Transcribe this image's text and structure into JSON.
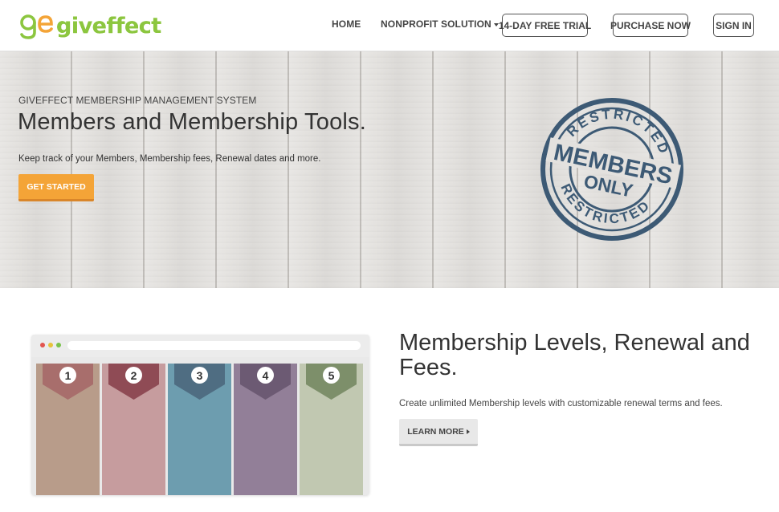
{
  "header": {
    "logo_text": "giveffect",
    "logo_mark": "ge",
    "nav": {
      "home": "HOME",
      "nonprofit": "NONPROFIT SOLUTION",
      "trial": "14-DAY FREE TRIAL",
      "purchase": "PURCHASE NOW",
      "signin": "SIGN IN"
    }
  },
  "hero": {
    "kicker": "GIVEFFECT MEMBERSHIP MANAGEMENT SYSTEM",
    "title": "Members and Membership Tools.",
    "description": "Keep track of your Members, Membership fees, Renewal dates and more.",
    "cta_label": "GET STARTED",
    "stamp": {
      "top_text": "RESTRICTED",
      "bottom_text": "RESTRICTED",
      "line1": "MEMBERS",
      "line2": "ONLY"
    }
  },
  "feature": {
    "title": "Membership Levels, Renewal and Fees.",
    "description": "Create unlimited Membership levels with customizable renewal terms and fees.",
    "button_label": "LEARN MORE",
    "levels": [
      {
        "number": "1",
        "column_color": "#b89c8a",
        "tag_color": "#a86e6c"
      },
      {
        "number": "2",
        "column_color": "#c69c9e",
        "tag_color": "#8f4b55"
      },
      {
        "number": "3",
        "column_color": "#6d9daf",
        "tag_color": "#4f6d82"
      },
      {
        "number": "4",
        "column_color": "#927f98",
        "tag_color": "#6c5a73"
      },
      {
        "number": "5",
        "column_color": "#c1c8b1",
        "tag_color": "#7d8f6a"
      }
    ]
  },
  "colors": {
    "brand_green": "#8cc63f",
    "brand_orange": "#f4a437",
    "stamp_blue": "#3d5a75"
  }
}
